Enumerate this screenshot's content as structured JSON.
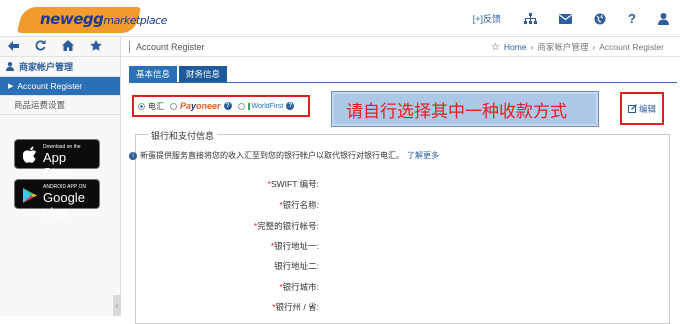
{
  "app": {
    "logo_main": "newegg",
    "logo_sub": "marketplace",
    "feedback": "[+]反馈"
  },
  "sidebar": {
    "group_label": "商家帐户管理",
    "items": [
      {
        "label": "Account Register",
        "active": true
      },
      {
        "label": "商品运费设置",
        "active": false
      }
    ],
    "appstore_small": "Download on the",
    "appstore_big": "App Store",
    "gplay_small": "ANDROID APP ON",
    "gplay_big": "Google play"
  },
  "header": {
    "page_title": "Account Register",
    "breadcrumb": [
      "Home",
      "商家帐户管理",
      "Account Register"
    ]
  },
  "tabs": [
    {
      "label": "基本信息",
      "selected": false
    },
    {
      "label": "财务信息",
      "selected": true
    }
  ],
  "payment": {
    "options": [
      "电汇",
      "Payoneer",
      "WorldFirst"
    ],
    "selected": "电汇",
    "callout": "请自行选择其中一种收款方式",
    "edit_label": "编辑"
  },
  "bank_section": {
    "legend": "银行和支付信息",
    "notice": "新蛋提供服务直接将您的收入汇至到您的银行帐户以取代银行对银行电汇。",
    "more_link": "了解更多",
    "fields": [
      {
        "label": "SWIFT 编号:",
        "required": true
      },
      {
        "label": "银行名称:",
        "required": true
      },
      {
        "label": "完整的银行帐号:",
        "required": true
      },
      {
        "label": "银行地址一:",
        "required": true
      },
      {
        "label": "银行地址二:",
        "required": false
      },
      {
        "label": "银行城市:",
        "required": true
      },
      {
        "label": "银行州 / 省:",
        "required": true
      }
    ]
  }
}
